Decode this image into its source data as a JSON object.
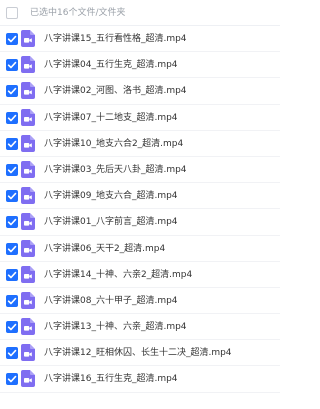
{
  "colors": {
    "accent": "#1e6fff",
    "video_icon": "#7f6df1",
    "header_text": "#9aa0a8",
    "row_divider": "#f1f2f5"
  },
  "header": {
    "selection_count": "已选中16个文件/文件夹"
  },
  "files": [
    {
      "name": "八字讲课15_五行看性格_超清.mp4",
      "icon": "video-file-icon",
      "checked": true
    },
    {
      "name": "八字讲课04_五行生克_超清.mp4",
      "icon": "video-file-icon",
      "checked": true
    },
    {
      "name": "八字讲课02_河图、洛书_超清.mp4",
      "icon": "video-file-icon",
      "checked": true
    },
    {
      "name": "八字讲课07_十二地支_超清.mp4",
      "icon": "video-file-icon",
      "checked": true
    },
    {
      "name": "八字讲课10_地支六合2_超清.mp4",
      "icon": "video-file-icon",
      "checked": true
    },
    {
      "name": "八字讲课03_先后天八卦_超清.mp4",
      "icon": "video-file-icon",
      "checked": true
    },
    {
      "name": "八字讲课09_地支六合_超清.mp4",
      "icon": "video-file-icon",
      "checked": true
    },
    {
      "name": "八字讲课01_八字前言_超清.mp4",
      "icon": "video-file-icon",
      "checked": true
    },
    {
      "name": "八字讲课06_天干2_超清.mp4",
      "icon": "video-file-icon",
      "checked": true
    },
    {
      "name": "八字讲课14_十神、六亲2_超清.mp4",
      "icon": "video-file-icon",
      "checked": true
    },
    {
      "name": "八字讲课08_六十甲子_超清.mp4",
      "icon": "video-file-icon",
      "checked": true
    },
    {
      "name": "八字讲课13_十神、六亲_超清.mp4",
      "icon": "video-file-icon",
      "checked": true
    },
    {
      "name": "八字讲课12_旺相休囚、长生十二决_超清.mp4",
      "icon": "video-file-icon",
      "checked": true
    },
    {
      "name": "八字讲课16_五行生克_超清.mp4",
      "icon": "video-file-icon",
      "checked": true
    }
  ]
}
